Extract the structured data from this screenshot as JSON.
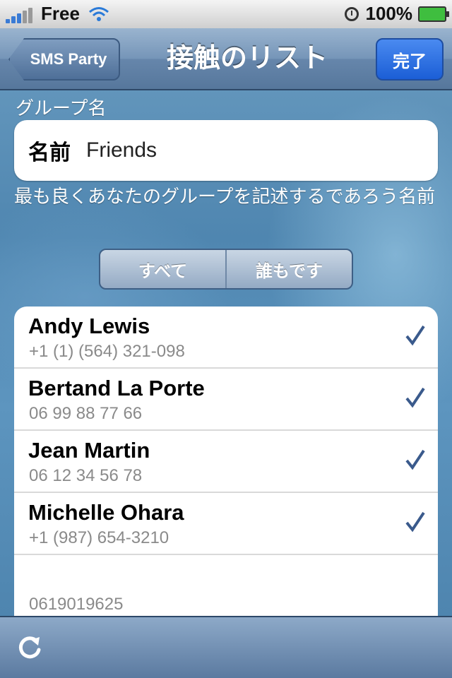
{
  "status_bar": {
    "carrier": "Free",
    "battery": "100%",
    "icons": [
      "signal-icon",
      "wifi-icon",
      "clock-icon",
      "battery-icon"
    ]
  },
  "nav": {
    "back_label": "SMS Party",
    "title": "接触のリスト",
    "done_label": "完了"
  },
  "group": {
    "section_label": "グループ名",
    "field_label": "名前",
    "field_value": "Friends",
    "hint": "最も良くあなたのグループを記述するであろう名前"
  },
  "segmented": {
    "items": [
      {
        "label": "すべて"
      },
      {
        "label": "誰もです"
      }
    ]
  },
  "contacts": [
    {
      "name": "Andy Lewis",
      "phone": "+1 (1) (564) 321-098",
      "checked": true
    },
    {
      "name": "Bertand La Porte",
      "phone": "06 99 88 77 66",
      "checked": true
    },
    {
      "name": "Jean Martin",
      "phone": "06 12 34 56 78",
      "checked": true
    },
    {
      "name": "Michelle Ohara",
      "phone": "+1 (987) 654-3210",
      "checked": true
    },
    {
      "name": "",
      "phone": "0619019625",
      "checked": false
    }
  ],
  "colors": {
    "nav": "#6686ab",
    "done_button": "#1b5ed6",
    "checkmark": "#3a5a8c"
  },
  "toolbar": {
    "icons": [
      "refresh-icon"
    ]
  }
}
